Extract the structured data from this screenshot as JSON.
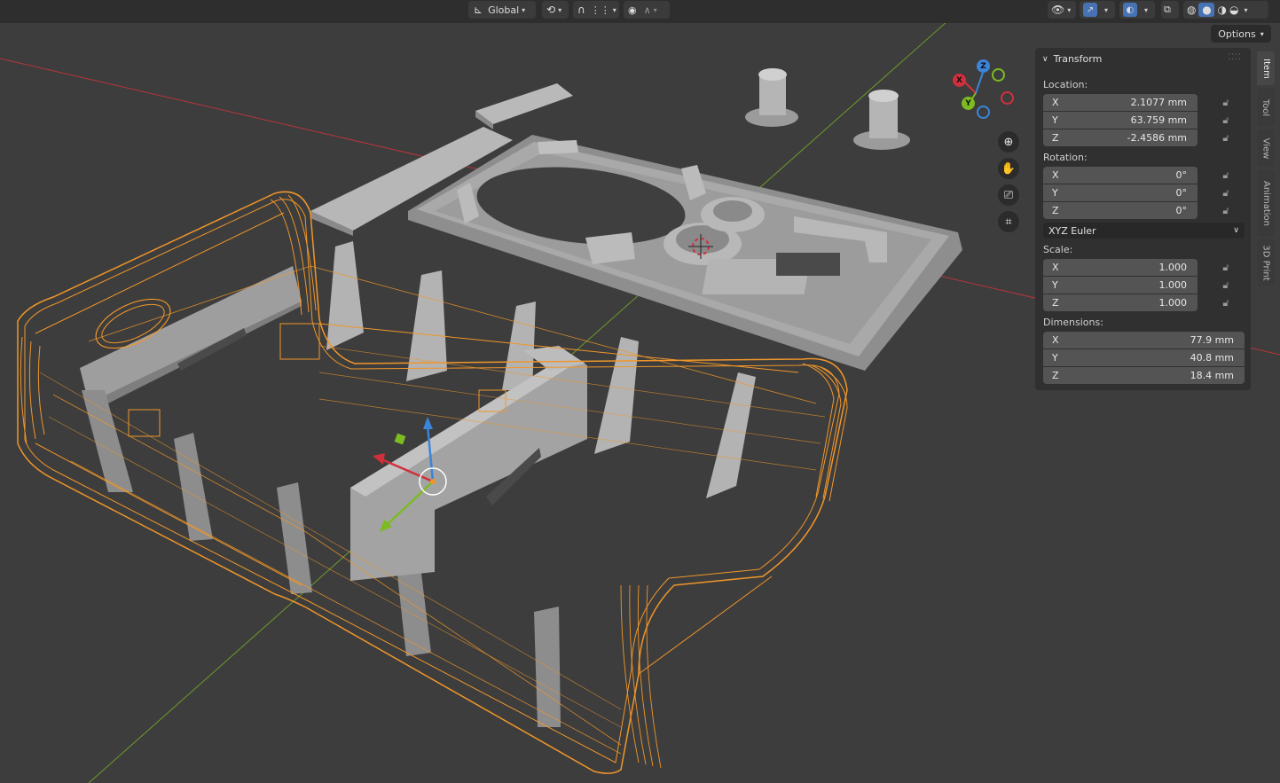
{
  "header": {
    "orientation_label": "Global",
    "options_label": "Options"
  },
  "gizmo": {
    "x_label": "X",
    "y_label": "Y",
    "z_label": "Z"
  },
  "panel": {
    "title": "Transform",
    "location_label": "Location:",
    "location": [
      {
        "axis": "X",
        "value": "2.1077 mm"
      },
      {
        "axis": "Y",
        "value": "63.759 mm"
      },
      {
        "axis": "Z",
        "value": "-2.4586 mm"
      }
    ],
    "rotation_label": "Rotation:",
    "rotation": [
      {
        "axis": "X",
        "value": "0°"
      },
      {
        "axis": "Y",
        "value": "0°"
      },
      {
        "axis": "Z",
        "value": "0°"
      }
    ],
    "rotation_mode": "XYZ Euler",
    "scale_label": "Scale:",
    "scale": [
      {
        "axis": "X",
        "value": "1.000"
      },
      {
        "axis": "Y",
        "value": "1.000"
      },
      {
        "axis": "Z",
        "value": "1.000"
      }
    ],
    "dimensions_label": "Dimensions:",
    "dimensions": [
      {
        "axis": "X",
        "value": "77.9 mm"
      },
      {
        "axis": "Y",
        "value": "40.8 mm"
      },
      {
        "axis": "Z",
        "value": "18.4 mm"
      }
    ]
  },
  "tabs": [
    "Item",
    "Tool",
    "View",
    "Animation",
    "3D Print"
  ],
  "colors": {
    "selection_orange": "#f0962a",
    "x_axis": "#d0303c",
    "y_axis": "#7cbb22",
    "z_axis": "#3b84d8",
    "mesh_gray": "#a4a4a4"
  }
}
